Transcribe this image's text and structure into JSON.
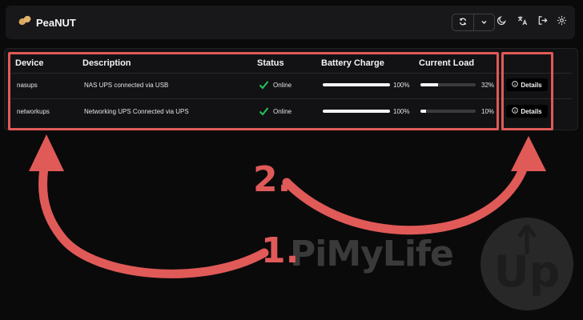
{
  "app": {
    "title": "PeaNUT"
  },
  "navbar": {
    "icons": [
      "refresh-icon",
      "chevron-down-icon",
      "moon-icon",
      "translate-icon",
      "logout-icon",
      "gear-icon"
    ]
  },
  "table": {
    "headers": {
      "device": "Device",
      "description": "Description",
      "status": "Status",
      "battery": "Battery Charge",
      "load": "Current Load"
    },
    "rows": [
      {
        "device": "nasups",
        "description": "NAS UPS connected via USB",
        "status": "Online",
        "battery_label": "100%",
        "battery_value": 100,
        "load_label": "32%",
        "load_value": 32,
        "action": "Details"
      },
      {
        "device": "networkups",
        "description": "Networking UPS Connected via UPS",
        "status": "Online",
        "battery_label": "100%",
        "battery_value": 100,
        "load_label": "10%",
        "load_value": 10,
        "action": "Details"
      }
    ]
  },
  "annotations": {
    "step1": "1.",
    "step2": "2.",
    "color": "#e05a58"
  },
  "watermark": {
    "text": "PiMyLife",
    "badge": "Up"
  },
  "colors": {
    "status_ok": "#22c55e",
    "accent": "#e05a58"
  }
}
